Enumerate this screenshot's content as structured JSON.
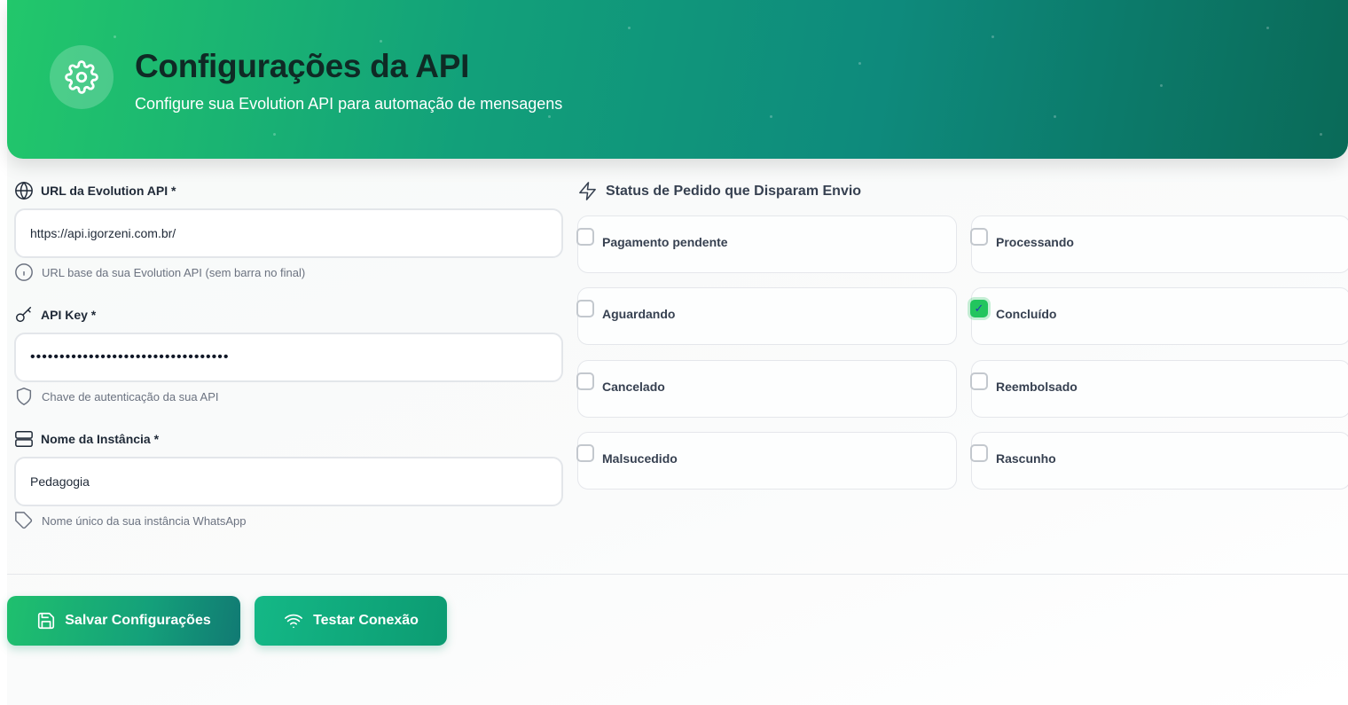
{
  "header": {
    "title": "Configurações da API",
    "subtitle": "Configure sua Evolution API para automação de mensagens",
    "icon": "gear-icon"
  },
  "form": {
    "url": {
      "label": "URL da Evolution API *",
      "value": "https://api.igorzeni.com.br/",
      "hint": "URL base da sua Evolution API (sem barra no final)"
    },
    "api_key": {
      "label": "API Key *",
      "value": "••••••••••••••••••••••••••••••••••",
      "hint": "Chave de autenticação da sua API"
    },
    "instance": {
      "label": "Nome da Instância *",
      "value": "Pedagogia",
      "hint": "Nome único da sua instância WhatsApp"
    }
  },
  "statuses": {
    "title": "Status de Pedido que Disparam Envio",
    "items": [
      {
        "label": "Pagamento pendente",
        "checked": false
      },
      {
        "label": "Processando",
        "checked": false
      },
      {
        "label": "Aguardando",
        "checked": false
      },
      {
        "label": "Concluído",
        "checked": true
      },
      {
        "label": "Cancelado",
        "checked": false
      },
      {
        "label": "Reembolsado",
        "checked": false
      },
      {
        "label": "Malsucedido",
        "checked": false
      },
      {
        "label": "Rascunho",
        "checked": false
      }
    ]
  },
  "actions": {
    "save_label": "Salvar Configurações",
    "test_label": "Testar Conexão"
  },
  "colors": {
    "accent": "#22c55e",
    "header_start": "#22c76b",
    "header_end": "#0a6a58"
  }
}
